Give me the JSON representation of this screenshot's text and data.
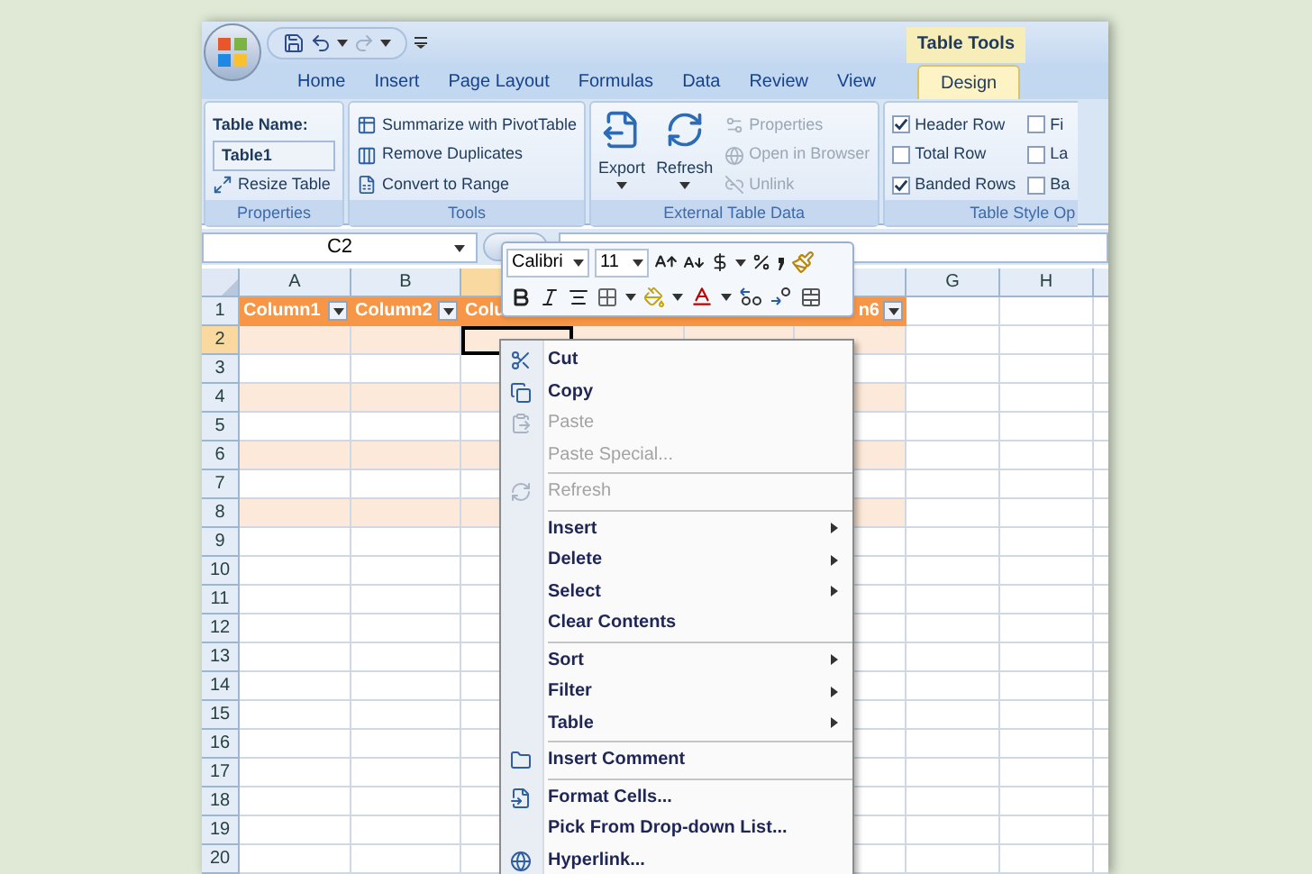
{
  "title_bar": {
    "contextual_group": "Table Tools"
  },
  "tabs": [
    {
      "label": "Home",
      "selected": false
    },
    {
      "label": "Insert",
      "selected": false
    },
    {
      "label": "Page Layout",
      "selected": false
    },
    {
      "label": "Formulas",
      "selected": false
    },
    {
      "label": "Data",
      "selected": false
    },
    {
      "label": "Review",
      "selected": false
    },
    {
      "label": "View",
      "selected": false
    },
    {
      "label": "Design",
      "selected": true
    }
  ],
  "ribbon_groups": [
    {
      "title": "Properties",
      "items": [
        {
          "kind": "label",
          "text": "Table Name:"
        },
        {
          "kind": "field",
          "value": "Table1"
        },
        {
          "kind": "small",
          "label": "Resize Table",
          "disabled": false
        }
      ]
    },
    {
      "title": "Tools",
      "items": [
        {
          "kind": "small",
          "label": "Summarize with PivotTable",
          "disabled": false
        },
        {
          "kind": "small",
          "label": "Remove Duplicates",
          "disabled": false
        },
        {
          "kind": "small",
          "label": "Convert to Range",
          "disabled": false
        }
      ]
    },
    {
      "title": "External Table Data",
      "items": [
        {
          "kind": "large",
          "label": "Export",
          "disabled": false
        },
        {
          "kind": "large",
          "label": "Refresh",
          "disabled": false
        },
        {
          "kind": "small",
          "label": "Properties",
          "disabled": true
        },
        {
          "kind": "small",
          "label": "Open in Browser",
          "disabled": true
        },
        {
          "kind": "small",
          "label": "Unlink",
          "disabled": true
        }
      ]
    },
    {
      "title": "Table Style Op",
      "items": [
        {
          "kind": "check",
          "label": "Header Row",
          "checked": true
        },
        {
          "kind": "check",
          "label": "Total Row",
          "checked": false
        },
        {
          "kind": "check",
          "label": "Banded Rows",
          "checked": true
        },
        {
          "kind": "check",
          "label": "Fi",
          "checked": false
        },
        {
          "kind": "check",
          "label": "La",
          "checked": false
        },
        {
          "kind": "check",
          "label": "Ba",
          "checked": false
        }
      ]
    }
  ],
  "formula_bar": {
    "name_box": "C2"
  },
  "column_headers": [
    {
      "label": "A",
      "selected": false
    },
    {
      "label": "B",
      "selected": false
    },
    {
      "selected": true
    },
    {
      "selected": false
    },
    {
      "label": "G",
      "selected": false
    },
    {
      "label": "H",
      "selected": false
    }
  ],
  "row_headers": [
    {
      "label": "1",
      "selected": false
    },
    {
      "label": "2",
      "selected": true
    },
    {
      "label": "3",
      "selected": false
    },
    {
      "label": "4",
      "selected": false
    },
    {
      "label": "5",
      "selected": false
    },
    {
      "label": "6",
      "selected": false
    },
    {
      "label": "7",
      "selected": false
    },
    {
      "label": "8",
      "selected": false
    },
    {
      "label": "9",
      "selected": false
    },
    {
      "label": "10",
      "selected": false
    },
    {
      "label": "11",
      "selected": false
    },
    {
      "label": "12",
      "selected": false
    },
    {
      "label": "13",
      "selected": false
    },
    {
      "label": "14",
      "selected": false
    },
    {
      "label": "15",
      "selected": false
    },
    {
      "label": "16",
      "selected": false
    },
    {
      "label": "17",
      "selected": false
    },
    {
      "label": "18",
      "selected": false
    },
    {
      "label": "19",
      "selected": false
    },
    {
      "label": "20",
      "selected": false
    }
  ],
  "table_header": [
    {
      "text": "Column1",
      "filter": true
    },
    {
      "text": "Column2",
      "filter": true
    },
    {
      "text": "Colu"
    },
    {
      "text": "n6",
      "filter": true
    }
  ],
  "mini_toolbar": {
    "font": "Calibri",
    "size": "11"
  },
  "context_menu": [
    {
      "label": "Cut",
      "disabled": false,
      "submenu": false,
      "separator_before": false
    },
    {
      "label": "Copy",
      "disabled": false,
      "submenu": false,
      "separator_before": false
    },
    {
      "label": "Paste",
      "disabled": true,
      "submenu": false,
      "separator_before": false
    },
    {
      "label": "Paste Special...",
      "disabled": true,
      "submenu": false,
      "separator_before": false
    },
    {
      "label": "Refresh",
      "disabled": true,
      "submenu": false,
      "separator_before": true
    },
    {
      "label": "Insert",
      "disabled": false,
      "submenu": true,
      "separator_before": true
    },
    {
      "label": "Delete",
      "disabled": false,
      "submenu": true,
      "separator_before": false
    },
    {
      "label": "Select",
      "disabled": false,
      "submenu": true,
      "separator_before": false
    },
    {
      "label": "Clear Contents",
      "disabled": false,
      "submenu": false,
      "separator_before": false
    },
    {
      "label": "Sort",
      "disabled": false,
      "submenu": true,
      "separator_before": true
    },
    {
      "label": "Filter",
      "disabled": false,
      "submenu": true,
      "separator_before": false
    },
    {
      "label": "Table",
      "disabled": false,
      "submenu": true,
      "separator_before": false
    },
    {
      "label": "Insert Comment",
      "disabled": false,
      "submenu": false,
      "separator_before": true
    },
    {
      "label": "Format Cells...",
      "disabled": false,
      "submenu": false,
      "separator_before": true
    },
    {
      "label": "Pick From Drop-down List...",
      "disabled": false,
      "submenu": false,
      "separator_before": false
    },
    {
      "label": "Hyperlink...",
      "disabled": false,
      "submenu": false,
      "separator_before": false
    }
  ]
}
